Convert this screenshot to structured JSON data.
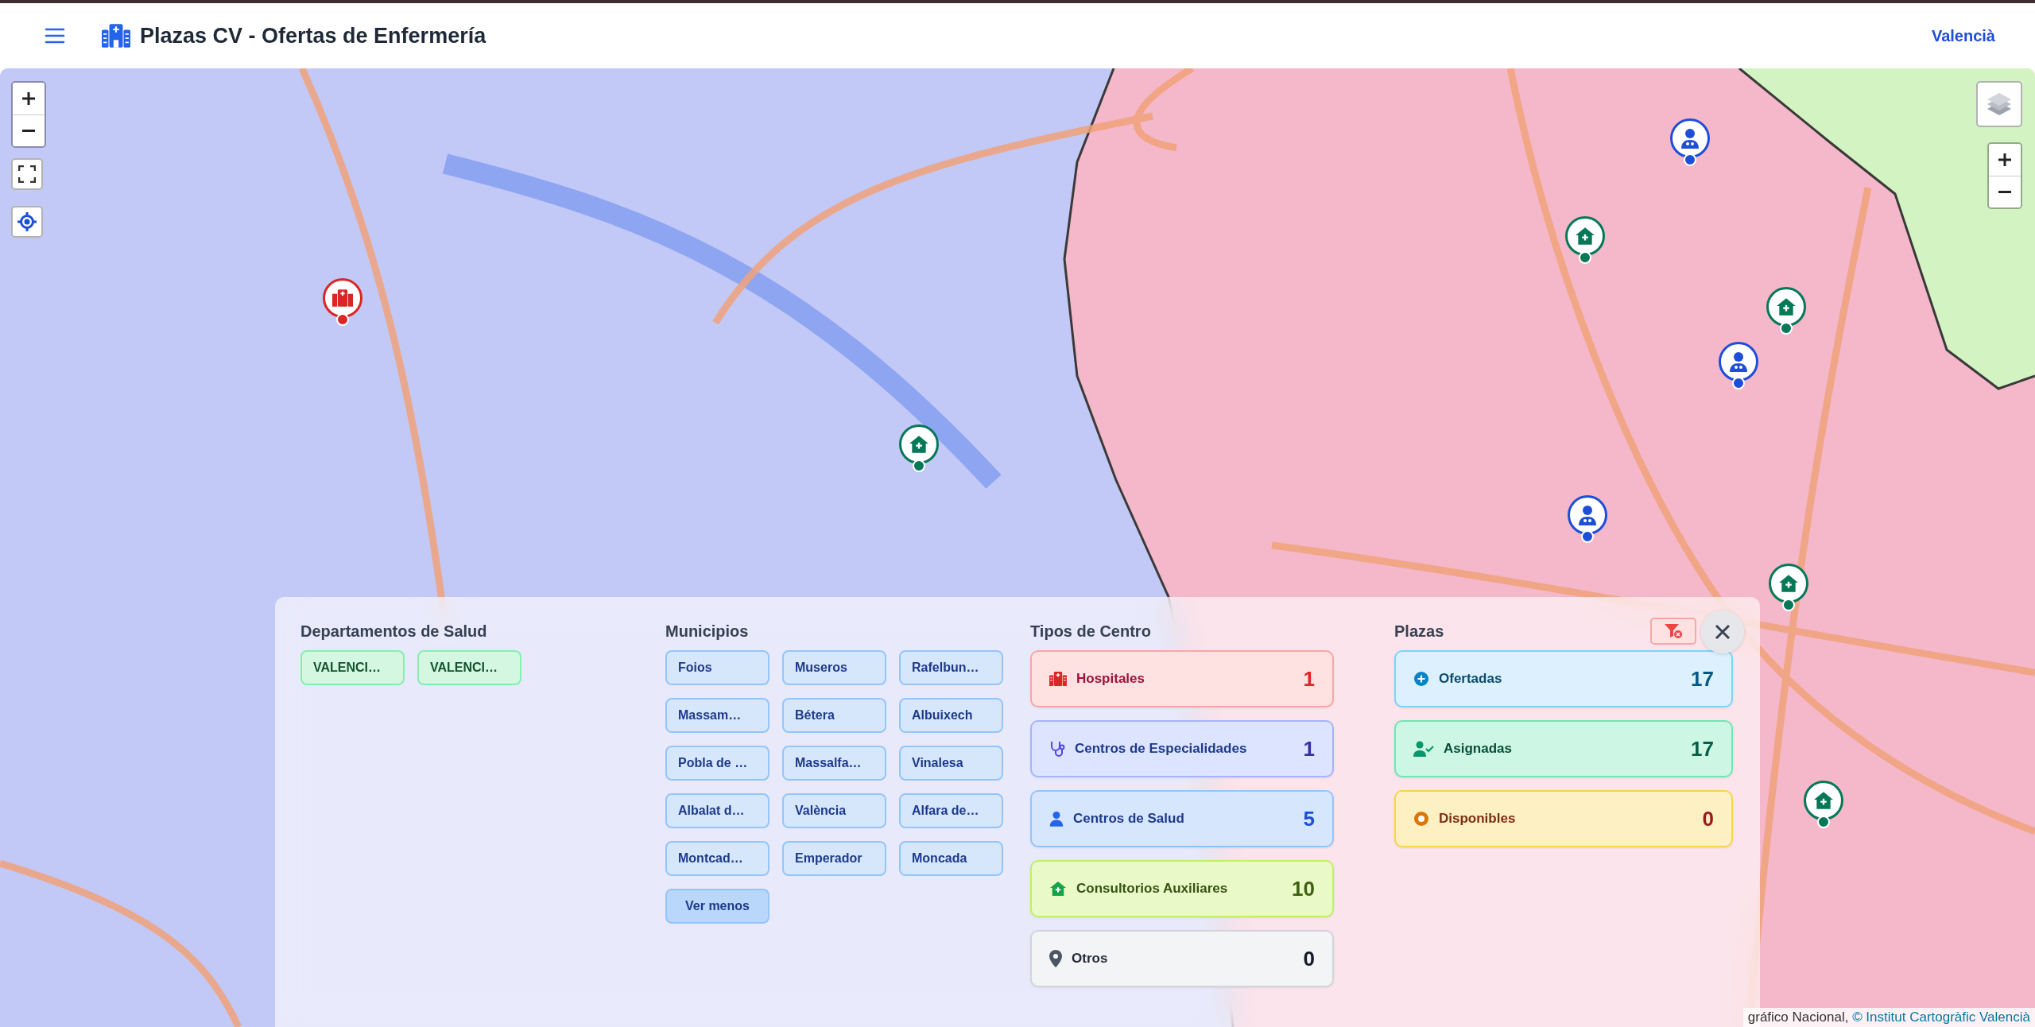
{
  "app_bar": {
    "title": "Plazas CV - Ofertas de Enfermería",
    "language_link": "Valencià"
  },
  "map": {
    "attribution": {
      "text": "gráfico Nacional, ",
      "link": "© Institut Cartogràfic Valencià"
    }
  },
  "filter_panel": {
    "departments": {
      "heading": "Departamentos de Salud",
      "items": [
        "VALENCI…",
        "VALENCI…"
      ]
    },
    "municipalities": {
      "heading": "Municipios",
      "items": [
        "Foios",
        "Museros",
        "Rafelbun…",
        "Massam…",
        "Bétera",
        "Albuixech",
        "Pobla de …",
        "Massalfa…",
        "Vinalesa",
        "Albalat d…",
        "València",
        "Alfara de…",
        "Montcad…",
        "Emperador",
        "Moncada"
      ],
      "toggle": "Ver menos"
    },
    "center_types": {
      "heading": "Tipos de Centro",
      "items": [
        {
          "kind": "hospital",
          "label": "Hospitales",
          "count": "1"
        },
        {
          "kind": "specialty",
          "label": "Centros de Especialidades",
          "count": "1"
        },
        {
          "kind": "health",
          "label": "Centros de Salud",
          "count": "5"
        },
        {
          "kind": "auxiliary",
          "label": "Consultorios Auxiliares",
          "count": "10"
        },
        {
          "kind": "other",
          "label": "Otros",
          "count": "0"
        }
      ]
    },
    "places": {
      "heading": "Plazas",
      "items": [
        {
          "kind": "offered",
          "label": "Ofertadas",
          "count": "17"
        },
        {
          "kind": "assigned",
          "label": "Asignadas",
          "count": "17"
        },
        {
          "kind": "available",
          "label": "Disponibles",
          "count": "0"
        }
      ]
    }
  }
}
